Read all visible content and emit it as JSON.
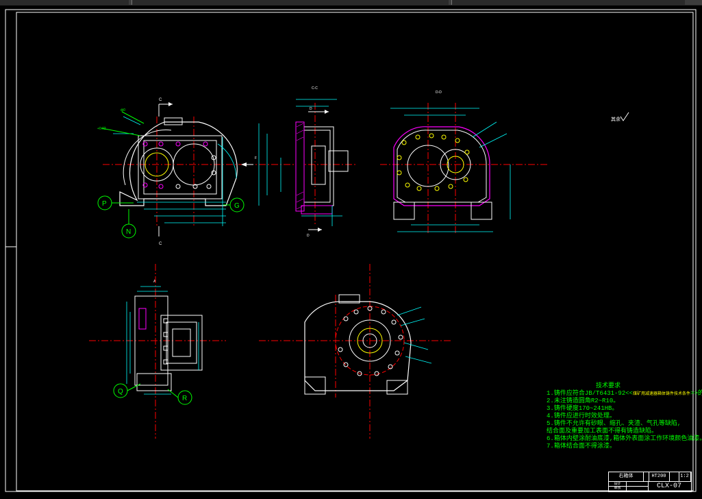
{
  "window": {
    "tabs": [
      "",
      "",
      ""
    ]
  },
  "colors": {
    "background": "#000000",
    "outline": "#ffffff",
    "centerline": "#ff0000",
    "dimension": "#00ffff",
    "annotation": "#00ff00",
    "hatch": "#ff00ff",
    "text": "#ffff00"
  },
  "views": {
    "front": {
      "section_label_top": "C",
      "section_label_bottom": "C"
    },
    "section_c": {
      "title": "C-C",
      "label_top": "D",
      "label_bottom": "D",
      "arrow_label": "F"
    },
    "section_d": {
      "title": "D-D"
    },
    "side_a": {
      "title": "A"
    }
  },
  "balloons": [
    "P",
    "G",
    "N",
    "Q",
    "R"
  ],
  "roughness_note": "其余",
  "notes": {
    "title": "技术要求",
    "lines": [
      {
        "num": "1.",
        "text": "铸件应符合JB/T6431-92<<",
        "small": "煤矿用减速器箱体铸件技术条件",
        "tail": ">>的规定。"
      },
      {
        "num": "2.",
        "text": "未注铸造圆角R2~R10。",
        "small": "",
        "tail": ""
      },
      {
        "num": "3.",
        "text": "铸件硬度170~241HB。",
        "small": "",
        "tail": ""
      },
      {
        "num": "4.",
        "text": "铸件应进行时效处理。",
        "small": "",
        "tail": ""
      },
      {
        "num": "5.",
        "text": "铸件不允许有砂眼、缩孔、夹渣、气孔等缺陷,",
        "small": "",
        "tail": ""
      },
      {
        "num": "",
        "text": "  结合面及重要加工表面不得有铸造缺陷。",
        "small": "",
        "tail": ""
      },
      {
        "num": "6.",
        "text": "箱体内壁涂耐油底漆,箱体外表面涂工作环境颜色油漆。",
        "small": "",
        "tail": ""
      },
      {
        "num": "7.",
        "text": "箱体结合面不得涂漆。",
        "small": "",
        "tail": ""
      }
    ]
  },
  "title_block": {
    "part_name": "右箱体",
    "material": "HT200",
    "scale": "1:2",
    "drawing_number": "CLX-07",
    "designer": "设计",
    "checker": "审核"
  }
}
